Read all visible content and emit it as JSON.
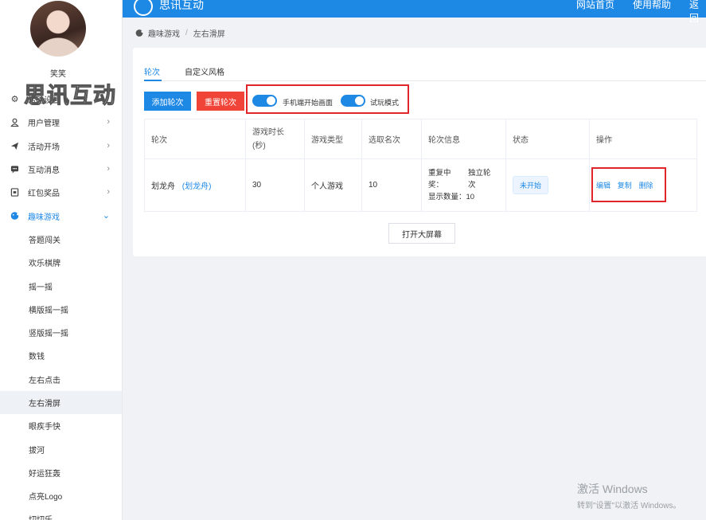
{
  "header": {
    "brand": "思讯互动",
    "nav": [
      "网站首页",
      "使用帮助",
      "返回"
    ]
  },
  "user": {
    "name": "笑笑"
  },
  "watermark": "思讯互动",
  "sidebar": {
    "items": [
      {
        "label": "活动设置",
        "icon": "gear-icon"
      },
      {
        "label": "用户管理",
        "icon": "user-icon"
      },
      {
        "label": "活动开场",
        "icon": "send-icon"
      },
      {
        "label": "互动消息",
        "icon": "chat-icon"
      },
      {
        "label": "红包奖品",
        "icon": "gift-icon"
      },
      {
        "label": "趣味游戏",
        "icon": "game-icon"
      }
    ],
    "subitems": [
      "答题闯关",
      "欢乐棋牌",
      "摇一摇",
      "横版摇一摇",
      "竖版摇一摇",
      "数钱",
      "左右点击",
      "左右滑屏",
      "眼疾手快",
      "拔河",
      "好运狂轰",
      "点亮Logo",
      "切切乐"
    ]
  },
  "breadcrumb": {
    "parent": "趣味游戏",
    "current": "左右滑屏"
  },
  "tabs": [
    "轮次",
    "自定义风格"
  ],
  "toolbar": {
    "add": "添加轮次",
    "reset": "重置轮次",
    "switch1": "手机端开始画面",
    "switch2": "试玩模式"
  },
  "table": {
    "headers": [
      "轮次",
      "游戏时长(秒)",
      "游戏类型",
      "选取名次",
      "轮次信息",
      "状态",
      "操作"
    ],
    "row": {
      "round_name": "划龙舟",
      "round_link": "(划龙舟)",
      "duration": "30",
      "type": "个人游戏",
      "rank": "10",
      "info_l1a": "重复中",
      "info_l1b": "独立轮",
      "info_l2a": "奖：",
      "info_l2b": "次",
      "info_l3": "显示数量：10",
      "status": "未开始",
      "ops": [
        "编辑",
        "复制",
        "删除"
      ]
    }
  },
  "big_screen_button": "打开大屏幕",
  "windows": {
    "line1": "激活 Windows",
    "line2": "转到\"设置\"以激活 Windows。"
  },
  "colors": {
    "primary": "#1e88e5",
    "danger": "#f04438",
    "highlight": "#e0262b"
  }
}
